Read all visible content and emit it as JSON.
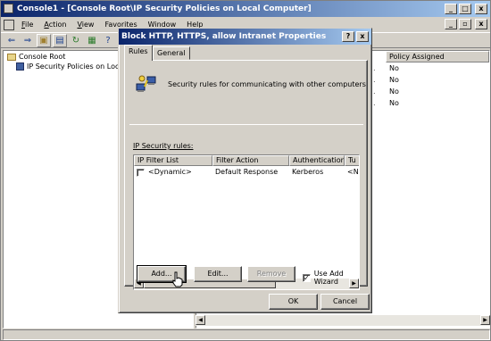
{
  "console": {
    "title": "Console1 - [Console Root\\IP Security Policies on Local Computer]",
    "menu": [
      {
        "mnemonic": "F",
        "rest": "ile"
      },
      {
        "mnemonic": "A",
        "rest": "ction"
      },
      {
        "mnemonic": "V",
        "rest": "iew"
      },
      {
        "pre": "Favo",
        "mnemonic": "r",
        "rest": "ites"
      },
      {
        "mnemonic": "W",
        "rest": "indow"
      },
      {
        "mnemonic": "H",
        "rest": "elp"
      }
    ],
    "tree": {
      "root": "Console Root",
      "child": "IP Security Policies on Local C"
    },
    "list": {
      "header_policy_assigned": "Policy Assigned",
      "rows": [
        "No",
        "No",
        "No",
        "No"
      ]
    }
  },
  "dialog": {
    "title": "Block HTTP, HTTPS, allow Intranet Properties",
    "help_button": "?",
    "close_button": "x",
    "tabs": [
      {
        "label": "Rules",
        "active": true
      },
      {
        "label": "General",
        "active": false
      }
    ],
    "description": "Security rules for communicating with other computers",
    "rules_label": "IP Security rules:",
    "columns": [
      "IP Filter List",
      "Filter Action",
      "Authentication...",
      "Tu"
    ],
    "rows": [
      {
        "filter_list": "<Dynamic>",
        "filter_action": "Default Response",
        "authentication": "Kerberos",
        "tunnel": "<N",
        "checked": false
      }
    ],
    "buttons": {
      "add": "Add...",
      "edit": "Edit...",
      "remove": "Remove",
      "use_wizard": "Use Add Wizard",
      "use_wizard_checked": true,
      "ok": "OK",
      "cancel": "Cancel"
    }
  }
}
